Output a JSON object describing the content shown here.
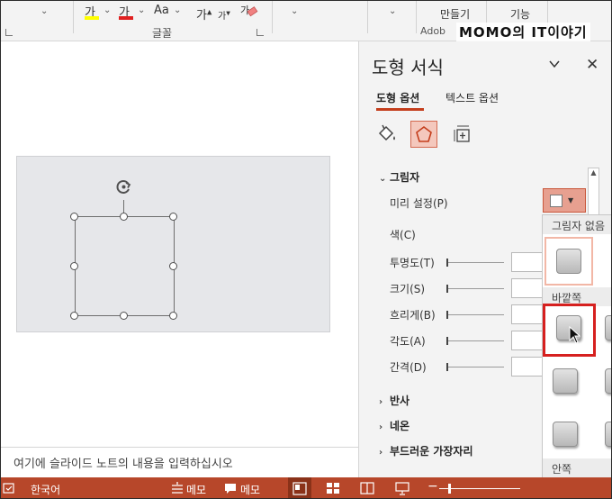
{
  "ribbon": {
    "font_group_label": "글꼴",
    "font_size_label": "Aa",
    "make_label": "만들기",
    "feature_label": "기능",
    "adobe_label": "Adob",
    "watermark": "MOMO의 IT이야기"
  },
  "slide": {
    "notes_placeholder": "여기에 슬라이드 노트의 내용을 입력하십시오"
  },
  "pane": {
    "title": "도형 서식",
    "tabs": [
      "도형 옵션",
      "텍스트 옵션"
    ],
    "active_tab": "도형 옵션",
    "shadow_section": "그림자",
    "preset_label": "미리 설정(P)",
    "color_label": "색(C)",
    "rows": [
      "투명도(T)",
      "크기(S)",
      "흐리게(B)",
      "각도(A)",
      "간격(D)"
    ],
    "collapsed_sections": [
      "반사",
      "네온",
      "부드러운 가장자리"
    ]
  },
  "gallery": {
    "no_shadow_label": "그림자 없음",
    "outer_label": "바깥쪽",
    "inner_label": "안쪽"
  },
  "status": {
    "language": "한국어",
    "notes_label": "메모",
    "comments_label": "메모"
  },
  "colors": {
    "accent": "#c43e1c",
    "status_bar": "#b7472a",
    "highlight_yellow": "#ffff00",
    "font_red": "#e02020",
    "selection_frame": "#d6201f"
  }
}
